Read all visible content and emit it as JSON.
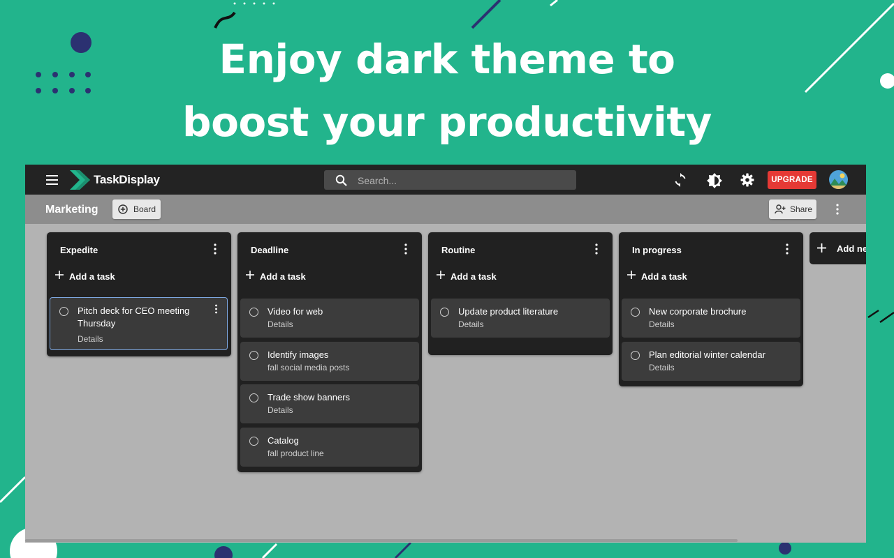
{
  "headline": {
    "line1": "Enjoy dark theme to",
    "line2": "boost your productivity"
  },
  "app": {
    "name": "TaskDisplay",
    "search": {
      "placeholder": "Search..."
    },
    "upgrade_label": "UPGRADE",
    "icons": [
      "menu-icon",
      "logo-icon",
      "search-icon",
      "sync-icon",
      "brightness-icon",
      "gear-icon",
      "avatar"
    ]
  },
  "board": {
    "title": "Marketing",
    "board_button_label": "Board",
    "share_label": "Share"
  },
  "columns": [
    {
      "title": "Expedite",
      "add_label": "Add a task",
      "tasks": [
        {
          "title": "Pitch deck for CEO meeting Thursday",
          "subtitle": "Details"
        }
      ]
    },
    {
      "title": "Deadline",
      "add_label": "Add a task",
      "tasks": [
        {
          "title": "Video for web",
          "subtitle": "Details"
        },
        {
          "title": "Identify images",
          "subtitle": "fall social media posts"
        },
        {
          "title": "Trade show banners",
          "subtitle": "Details"
        },
        {
          "title": "Catalog",
          "subtitle": "fall product line"
        }
      ]
    },
    {
      "title": "Routine",
      "add_label": "Add a task",
      "tasks": [
        {
          "title": "Update product literature",
          "subtitle": "Details"
        }
      ]
    },
    {
      "title": "In progress",
      "add_label": "Add a task",
      "tasks": [
        {
          "title": "New corporate brochure",
          "subtitle": "Details"
        },
        {
          "title": "Plan editorial winter calendar",
          "subtitle": "Details"
        }
      ]
    }
  ],
  "add_column_label": "Add new",
  "colors": {
    "background": "#22b48c",
    "accent": "#22b48c",
    "upgrade": "#e53935",
    "dark_surface": "#212121",
    "card": "#3c3c3c",
    "selected_outline": "#7da7e0",
    "decor_navy": "#2b3171"
  }
}
